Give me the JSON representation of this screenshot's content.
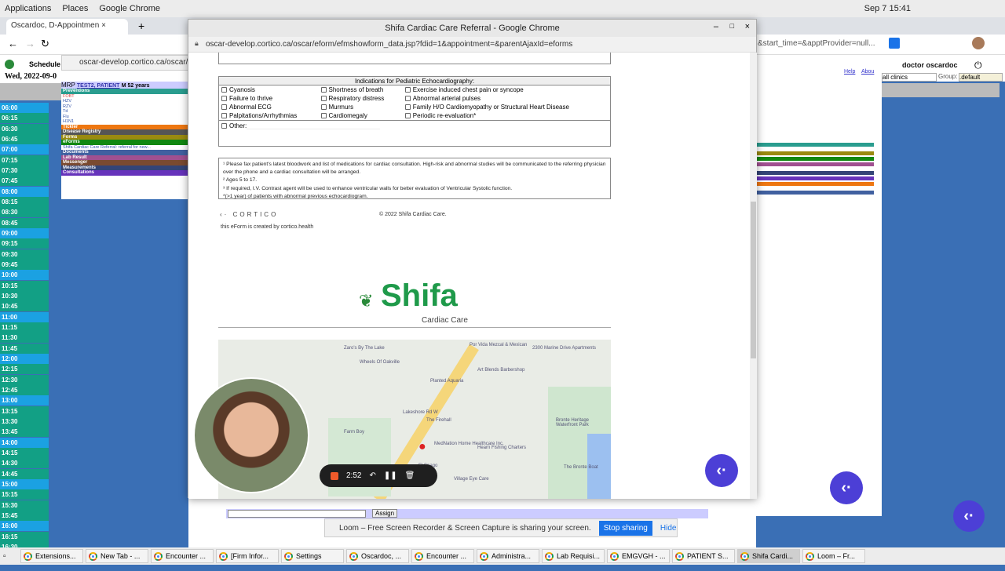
{
  "desktop": {
    "menu": [
      "Applications",
      "Places",
      "Google Chrome"
    ],
    "clock": "Sep 7  15:41"
  },
  "bg_window": {
    "tab_title": "Oscardoc, D-Appointmen",
    "schedule_label": "Schedule",
    "date": "Wed, 2022-09-0",
    "url_left": "oscar-develop.cortico.ca/oscar/ca",
    "url_right": "&start_time=&apptProvider=null...",
    "user": "doctor oscardoc",
    "clinic_select": "all clinics",
    "group_label": "Group:",
    "group_select": ".default",
    "help": "Help",
    "about": "Abou",
    "times": [
      "06:00",
      "06:15",
      "06:30",
      "06:45",
      "07:00",
      "07:15",
      "07:30",
      "07:45",
      "08:00",
      "08:15",
      "08:30",
      "08:45",
      "09:00",
      "09:15",
      "09:30",
      "09:45",
      "10:00",
      "10:15",
      "10:30",
      "10:45",
      "11:00",
      "11:15",
      "11:30",
      "11:45",
      "12:00",
      "12:15",
      "12:30",
      "12:45",
      "13:00",
      "13:15",
      "13:30",
      "13:45",
      "14:00",
      "14:15",
      "14:30",
      "14:45",
      "15:00",
      "15:15",
      "15:30",
      "15:45",
      "16:00",
      "16:15",
      "16:30"
    ],
    "hour_color": "#1ba1e2",
    "quarter_color": "#12a085"
  },
  "encounter": {
    "mrp": "MRP",
    "patient": "TEST2, PATIENT",
    "info": "M 52 years",
    "sections": [
      {
        "label": "Preventions",
        "color": "#2a9d8f"
      },
      {
        "label": "Tickler",
        "color": "#ee7711"
      },
      {
        "label": "Disease Registry",
        "color": "#555555"
      },
      {
        "label": "Forms",
        "color": "#9a8a10"
      },
      {
        "label": "eForms",
        "color": "#118811"
      },
      {
        "label": "Documents",
        "color": "#4060a0"
      },
      {
        "label": "Lab Result",
        "color": "#a05090"
      },
      {
        "label": "Messenger",
        "color": "#7a4a30"
      },
      {
        "label": "Measurements",
        "color": "#334477"
      },
      {
        "label": "Consultations",
        "color": "#6633bb"
      }
    ],
    "preventions": [
      "FOBT",
      "HZV",
      "RZV",
      "Td",
      "Flu",
      "H1N1"
    ],
    "eform_item": "Shifa Cardiac Care Referral: referral for new..."
  },
  "popup": {
    "title": "Shifa Cardiac Care Referral - Google Chrome",
    "url": "oscar-develop.cortico.ca/oscar/eform/efmshowform_data.jsp?fdid=1&appointment=&parentAjaxId=eforms",
    "indications_title": "Indications for Pediatric Echocardiography:",
    "rows": [
      [
        "Cyanosis",
        "Shortness of breath",
        "Exercise induced chest pain or syncope"
      ],
      [
        "Failure to thrive",
        "Respiratory distress",
        "Abnormal arterial pulses"
      ],
      [
        "Abnormal ECG",
        "Murmurs",
        "Family H/O Cardiomyopathy or Structural Heart Disease"
      ],
      [
        "Palpitations/Arrhythmias",
        "Cardiomegaly",
        "Periodic re-evaluation*"
      ]
    ],
    "other_label": "Other:",
    "notes": [
      "¹ Please fax patient's latest bloodwork and list of medications for cardiac consultation. High-risk and abnormal studies will be communicated to the referring physician over the phone and a cardiac consultation will be arranged.",
      "² Ages 5 to 17.",
      "³ If required, I.V. Contrast agent will be used to enhance ventricular walls for better evaluation of Ventricular Systolic function.",
      "*(>1 year) of patients with abnormal previous echocardiogram."
    ],
    "cortico_logo": "CORTICO",
    "created_by": "this eForm is created by cortico.health",
    "copyright": "© 2022 Shifa Cardiac Care.",
    "shifa_logo": "Shifa",
    "shifa_sub": "Cardiac Care",
    "map_labels": [
      "Zaro's By The Lake",
      "Por Vida Mezcal & Mexican",
      "2300 Marine Drive Apartments",
      "Wheels Of Oakville",
      "Art Blends Barbershop",
      "Planted Aquaria",
      "Lakeshore Rd W",
      "Farm Boy",
      "The Firehall",
      "Hearn Fishing Charters",
      "Bronte Heritage Waterfront Park",
      "MedNation Home Healthcare Inc.",
      "El Spago",
      "Village Eye Care",
      "The Bronte Boat"
    ]
  },
  "recorder": {
    "time": "2:52"
  },
  "assign_label": "Assign",
  "loom": {
    "message": "Loom – Free Screen Recorder & Screen Capture is sharing your screen.",
    "stop": "Stop sharing",
    "hide": "Hide"
  },
  "taskbar": [
    "Extensions...",
    "New Tab - ...",
    "Encounter ...",
    "[Firm Infor...",
    "Settings",
    "Oscardoc, ...",
    "Encounter ...",
    "Administra...",
    "Lab Requisi...",
    "EMGVGH - ...",
    "PATIENT S...",
    "Shifa Cardi...",
    "Loom – Fr..."
  ]
}
